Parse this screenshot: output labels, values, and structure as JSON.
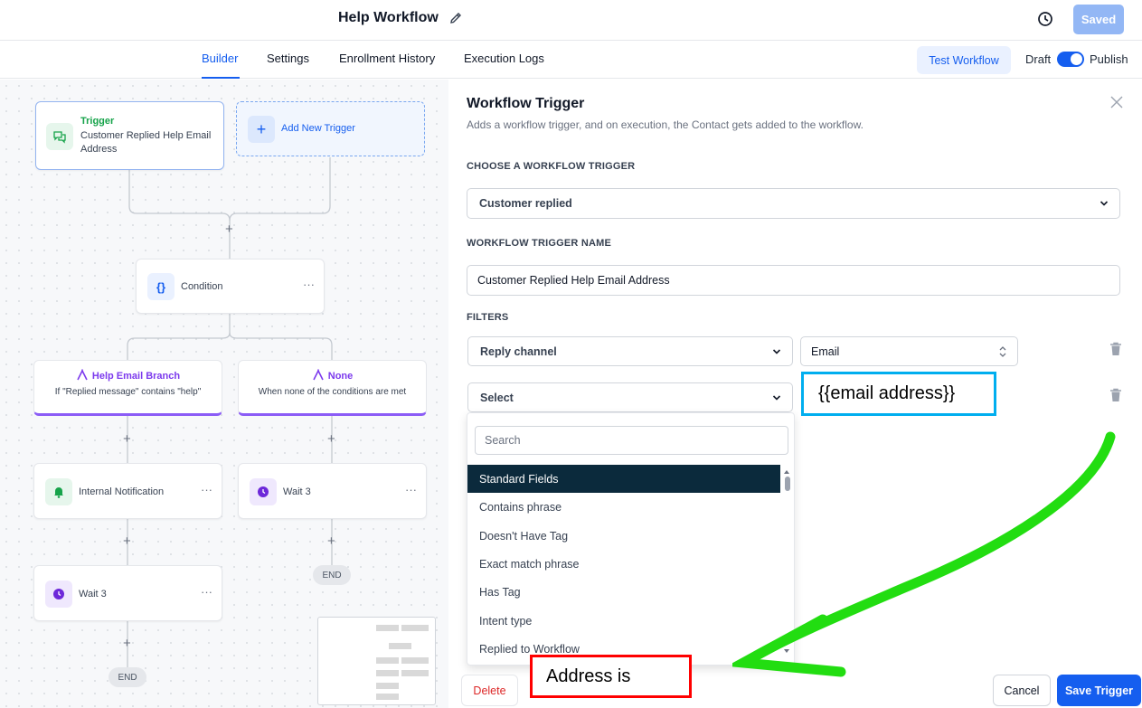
{
  "header": {
    "title": "Help Workflow",
    "saved_label": "Saved"
  },
  "tabs": [
    {
      "label": "Builder",
      "active": true
    },
    {
      "label": "Settings"
    },
    {
      "label": "Enrollment History"
    },
    {
      "label": "Execution Logs"
    }
  ],
  "actions": {
    "test_label": "Test Workflow",
    "draft_label": "Draft",
    "publish_label": "Publish",
    "publish_on": true
  },
  "canvas": {
    "trigger": {
      "title": "Trigger",
      "line1": "Customer Replied Help Email",
      "line2": "Address"
    },
    "add_trigger": "Add New Trigger",
    "condition": "Condition",
    "branch1": {
      "title": "Help Email Branch",
      "subtitle": "If \"Replied message\" contains \"help\""
    },
    "branch2": {
      "title": "None",
      "subtitle": "When none of the conditions are met"
    },
    "internal_notification": "Internal Notification",
    "wait_right": "Wait 3",
    "wait_left": "Wait 3",
    "end_label": "END",
    "more_label": "···",
    "plus_label": "+"
  },
  "panel": {
    "title": "Workflow Trigger",
    "subtitle": "Adds a workflow trigger, and on execution, the Contact gets added to the workflow.",
    "choose_label": "CHOOSE A WORKFLOW TRIGGER",
    "trigger_value": "Customer replied",
    "name_label": "WORKFLOW TRIGGER NAME",
    "name_value": "Customer Replied Help Email Address",
    "filters_label": "FILTERS",
    "filter1_field": "Reply channel",
    "filter1_value": "Email",
    "filter2_field": "Select",
    "dropdown": {
      "search_placeholder": "Search",
      "items": [
        "Standard Fields",
        "Contains phrase",
        "Doesn't Have Tag",
        "Exact match phrase",
        "Has Tag",
        "Intent type",
        "Replied to Workflow"
      ]
    },
    "delete_label": "Delete",
    "cancel_label": "Cancel",
    "save_label": "Save Trigger"
  },
  "annotations": {
    "blue_box": "{{email address}}",
    "red_box": "Address is",
    "arrow_color": "#22dd11"
  },
  "colors": {
    "accent": "#155eef",
    "branch": "#8b5cf6",
    "trigger_green": "#16a34a"
  }
}
